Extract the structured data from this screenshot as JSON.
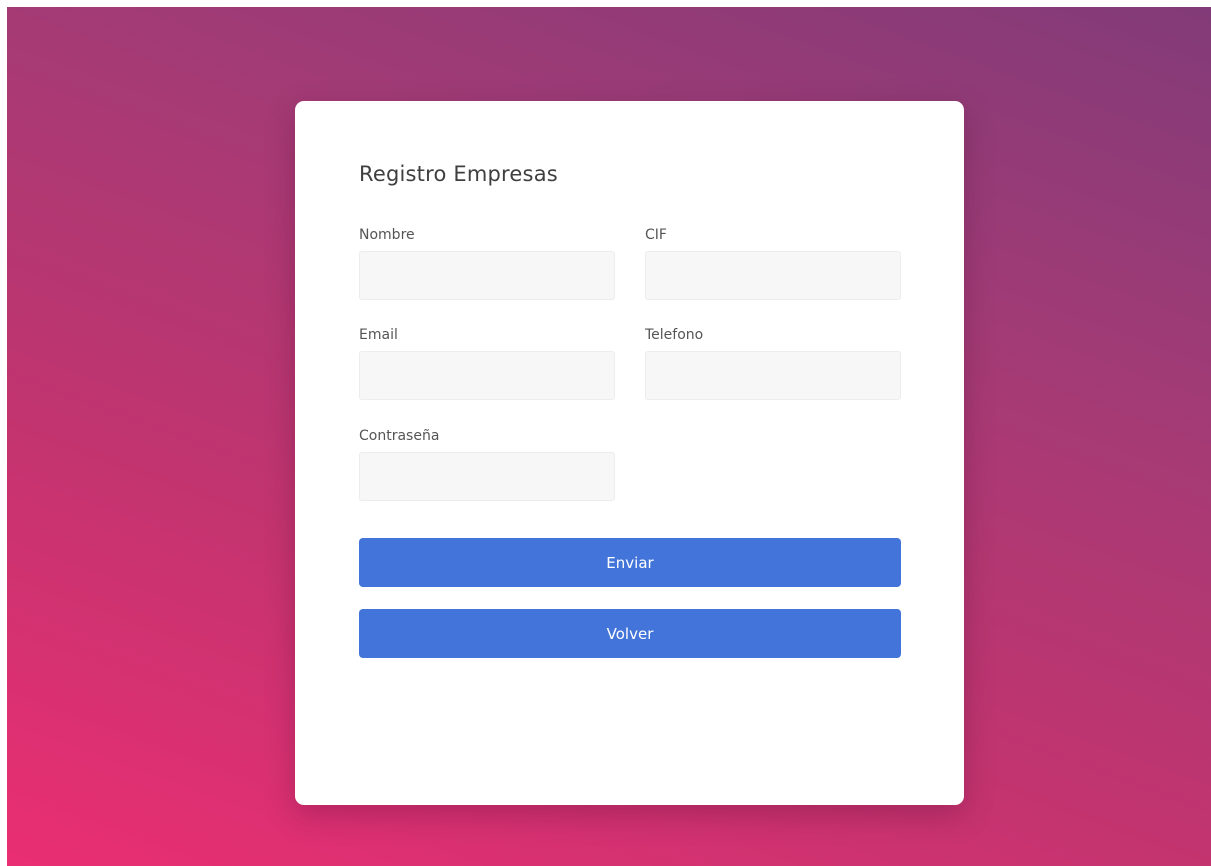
{
  "form": {
    "title": "Registro Empresas",
    "fields": {
      "nombre": {
        "label": "Nombre",
        "value": ""
      },
      "cif": {
        "label": "CIF",
        "value": ""
      },
      "email": {
        "label": "Email",
        "value": ""
      },
      "telefono": {
        "label": "Telefono",
        "value": ""
      },
      "password": {
        "label": "Contraseña",
        "value": ""
      }
    },
    "submit_label": "Enviar",
    "back_label": "Volver"
  },
  "colors": {
    "button": "#4374d9",
    "card": "#ffffff",
    "input_bg": "#f7f7f7",
    "gradient_top_right": "#823b78",
    "gradient_bottom_left": "#ea2e73"
  }
}
